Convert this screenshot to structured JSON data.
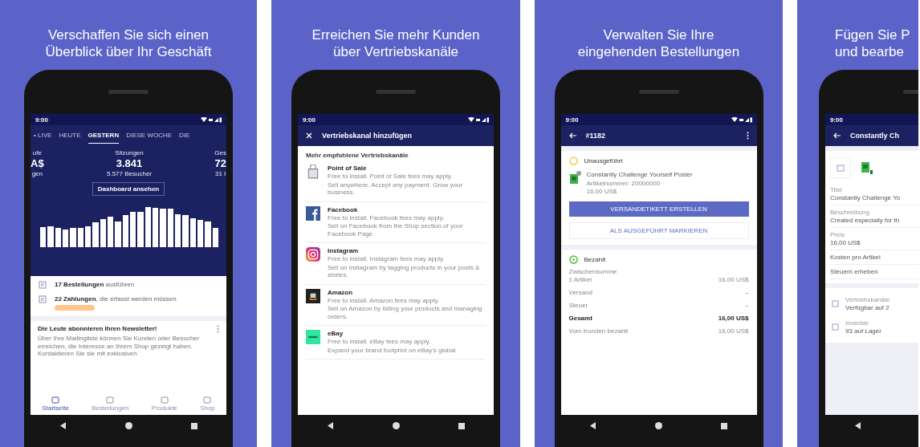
{
  "panels": [
    {
      "kind": "dashboard",
      "headline": [
        "Verschaffen Sie sich einen",
        "Überblick über Ihr Geschäft"
      ],
      "status_time": "9:00",
      "tabs": [
        {
          "label": "• LIVE",
          "selected": false
        },
        {
          "label": "HEUTE",
          "selected": false
        },
        {
          "label": "GESTERN",
          "selected": true
        },
        {
          "label": "DIESE WOCHE",
          "selected": false
        },
        {
          "label": "DIE",
          "selected": false
        }
      ],
      "stats": [
        {
          "label": "ufe",
          "value": "A$",
          "sub": "gen"
        },
        {
          "label": "Sitzungen",
          "value": "3.841",
          "sub": "5.577 Besucher"
        },
        {
          "label": "Ges",
          "value": "72",
          "sub": "31 I"
        }
      ],
      "dashboard_button": "Dashboard ansehen",
      "tasks": [
        {
          "text": "**17 Bestellungen** ausführen",
          "tag": false
        },
        {
          "text": "**22 Zahlungen**, die erfasst werden müssen",
          "tag": true
        }
      ],
      "card": {
        "title": "Die Leute abonnieren Ihren Newsletter!",
        "body": "Über Ihre Mailingliste können Sie Kunden oder Besucher erreichen, die Interesse an Ihrem Shop gezeigt haben. Kontaktieren Sie sie mit exklusiven"
      },
      "nav": [
        {
          "label": "Startseite",
          "selected": true
        },
        {
          "label": "Bestellungen",
          "selected": false
        },
        {
          "label": "Produkte",
          "selected": false
        },
        {
          "label": "Shop",
          "selected": false
        }
      ]
    },
    {
      "kind": "channels",
      "headline": [
        "Erreichen Sie mehr Kunden",
        "über Vertriebskanäle"
      ],
      "status_time": "9:00",
      "title": "Vertriebskanal hinzufügen",
      "section": "Mehr empfohlene Vertriebskanäle",
      "channels": [
        {
          "kind": "pos",
          "name": "Point of Sale",
          "fees": "Free to install. Point of Sale fees may apply.",
          "description": "Sell anywhere. Accept any payment. Grow your business."
        },
        {
          "kind": "facebook",
          "name": "Facebook",
          "fees": "Free to install. Facebook fees may apply.",
          "description": "Sell on Facebook from the Shop section of your Facebook Page."
        },
        {
          "kind": "instagram",
          "name": "Instagram",
          "fees": "Free to install. Instagram fees may apply.",
          "description": "Sell on Instagram by tagging products in your posts & stories."
        },
        {
          "kind": "amazon",
          "name": "Amazon",
          "fees": "Free to install. Amazon fees may apply.",
          "description": "Sell on Amazon by listing your products and managing orders."
        },
        {
          "kind": "ebay",
          "name": "eBay",
          "fees": "Free to install. eBay fees may apply.",
          "description": "Expand your brand footprint on eBay's global"
        }
      ]
    },
    {
      "kind": "order",
      "headline": [
        "Verwalten Sie Ihre",
        "eingehenden Bestellungen"
      ],
      "status_time": "9:00",
      "title": "#1182",
      "status": "Unausgeführt",
      "product": {
        "name": "Constantly Challenge Yourself Poster",
        "sku": "Artikelnummer: 20000000",
        "price": "16,00 US$"
      },
      "primary_button": "VERSANDETIKETT ERSTELLEN",
      "secondary_button": "ALS AUSGEFÜHRT MARKIEREN",
      "payment_status": "Bezahlt",
      "totals": [
        {
          "label": "Zwischensumme",
          "sub": "1 Artikel",
          "value": "16,00 US$",
          "bold": false
        },
        {
          "label": "Versand",
          "value": "–",
          "bold": false
        },
        {
          "label": "Steuer",
          "value": "–",
          "bold": false
        },
        {
          "label": "Gesamt",
          "value": "16,00 US$",
          "bold": true
        },
        {
          "label": "Vom Kunden bezahlt",
          "value": "16,00 US$",
          "bold": false
        }
      ]
    },
    {
      "kind": "product",
      "headline": [
        "Fügen Sie P",
        "und bearbe"
      ],
      "status_time": "9:00",
      "title": "Constantly Ch",
      "fields": [
        {
          "label": "Titel",
          "value": "Constantly Challenge Yo"
        },
        {
          "label": "Beschreibung",
          "value": "Created especially for th"
        },
        {
          "label": "Preis",
          "value": "16,00 US$"
        },
        {
          "label": "Kosten pro Artikel"
        },
        {
          "label": "Steuern erheben"
        }
      ],
      "links": [
        {
          "label": "Vertriebskanäle",
          "value": "Verfügbar auf 2"
        },
        {
          "label": "Inventar",
          "value": "93 auf Lager"
        }
      ]
    }
  ]
}
